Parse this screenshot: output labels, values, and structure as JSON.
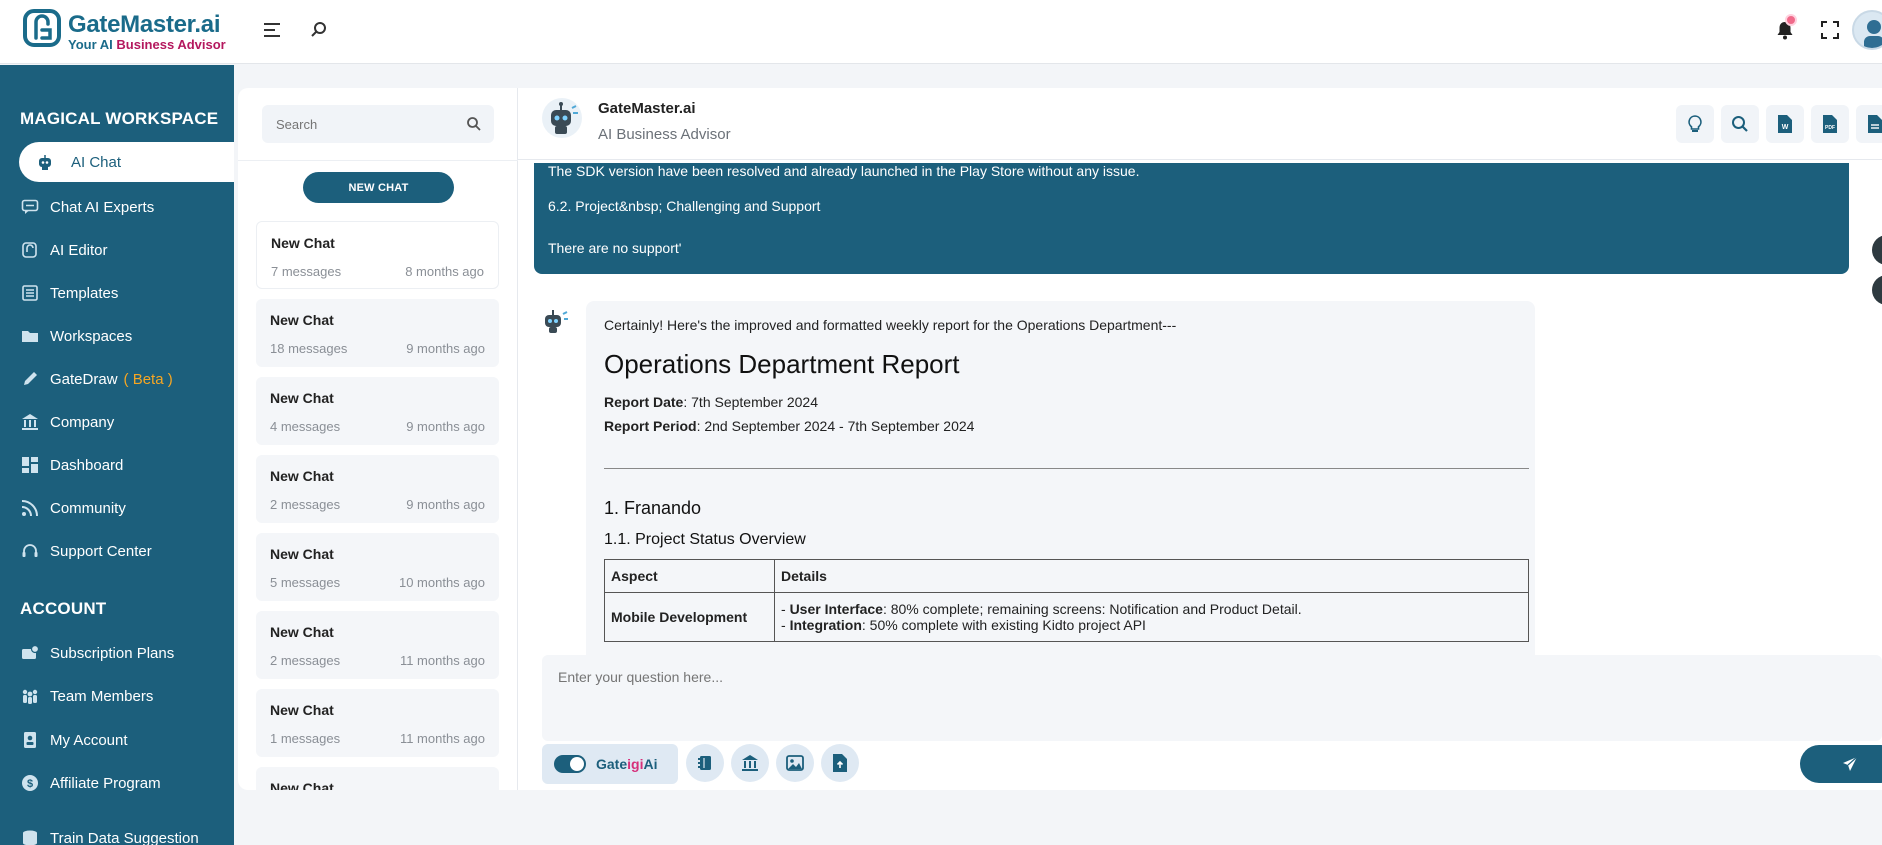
{
  "brand": {
    "name": "GateMaster",
    "name_suffix": ".ai",
    "tagline_a": "Your AI ",
    "tagline_b": "Business Advisor"
  },
  "sidebar": {
    "workspace_heading": "MAGICAL WORKSPACE",
    "account_heading": "ACCOUNT",
    "items": [
      {
        "label": "AI Chat",
        "icon": "robot-icon"
      },
      {
        "label": "Chat AI Experts",
        "icon": "chat-icon"
      },
      {
        "label": "AI Editor",
        "icon": "editor-icon"
      },
      {
        "label": "Templates",
        "icon": "templates-icon"
      },
      {
        "label": "Workspaces",
        "icon": "folder-icon"
      },
      {
        "label": "GateDraw",
        "badge": "( Beta )",
        "icon": "pencil-icon"
      },
      {
        "label": "Company",
        "icon": "bank-icon"
      },
      {
        "label": "Dashboard",
        "icon": "dashboard-icon"
      },
      {
        "label": "Community",
        "icon": "rss-icon"
      },
      {
        "label": "Support Center",
        "icon": "headset-icon"
      }
    ],
    "account_items": [
      {
        "label": "Subscription Plans",
        "icon": "plans-icon"
      },
      {
        "label": "Team Members",
        "icon": "team-icon"
      },
      {
        "label": "My Account",
        "icon": "account-icon"
      },
      {
        "label": "Affiliate Program",
        "icon": "dollar-icon"
      },
      {
        "label": "Train Data Suggestion",
        "icon": "database-icon"
      }
    ]
  },
  "chatlist": {
    "search_placeholder": "Search",
    "new_chat_label": "NEW CHAT",
    "chats": [
      {
        "title": "New Chat",
        "messages": "7 messages",
        "age": "8 months ago"
      },
      {
        "title": "New Chat",
        "messages": "18 messages",
        "age": "9 months ago"
      },
      {
        "title": "New Chat",
        "messages": "4 messages",
        "age": "9 months ago"
      },
      {
        "title": "New Chat",
        "messages": "2 messages",
        "age": "9 months ago"
      },
      {
        "title": "New Chat",
        "messages": "5 messages",
        "age": "10 months ago"
      },
      {
        "title": "New Chat",
        "messages": "2 messages",
        "age": "11 months ago"
      },
      {
        "title": "New Chat",
        "messages": "1 messages",
        "age": "11 months ago"
      },
      {
        "title": "New Chat",
        "messages": "",
        "age": ""
      }
    ]
  },
  "chat": {
    "title": "GateMaster.ai",
    "subtitle": "AI Business Advisor",
    "user_message": {
      "line1": "The SDK version have been resolved and already launched in the Play Store without any issue.",
      "line2": "6.2. Project&nbsp; Challenging and Support",
      "line3": "There are no support'"
    },
    "bot_message": {
      "intro": "Certainly! Here's the improved and formatted weekly report for the Operations Department---",
      "heading": "Operations Department Report",
      "report_date_label": "Report Date",
      "report_date_value": ": 7th September 2024",
      "report_period_label": "Report Period",
      "report_period_value": ": 2nd September 2024 - 7th September 2024",
      "section": "1. Franando",
      "subsection": "1.1. Project Status Overview",
      "table_headers": [
        "Aspect",
        "Details"
      ],
      "row_aspect": "Mobile Development",
      "row_d1_prefix": "- ",
      "row_d1_label": "User Interface",
      "row_d1_text": ": 80% complete; remaining screens: Notification and Product Detail.",
      "row_d2_prefix": "- ",
      "row_d2_label": "Integration",
      "row_d2_text": ": 50% complete with existing Kidto project API"
    },
    "input_placeholder": "Enter your question here...",
    "toggle_label_a": "Gate",
    "toggle_label_b": "igi",
    "toggle_label_c": "Ai"
  },
  "colors": {
    "primary": "#1c5f7c",
    "accent_pink": "#b4185e",
    "beta_orange": "#f5a623"
  }
}
